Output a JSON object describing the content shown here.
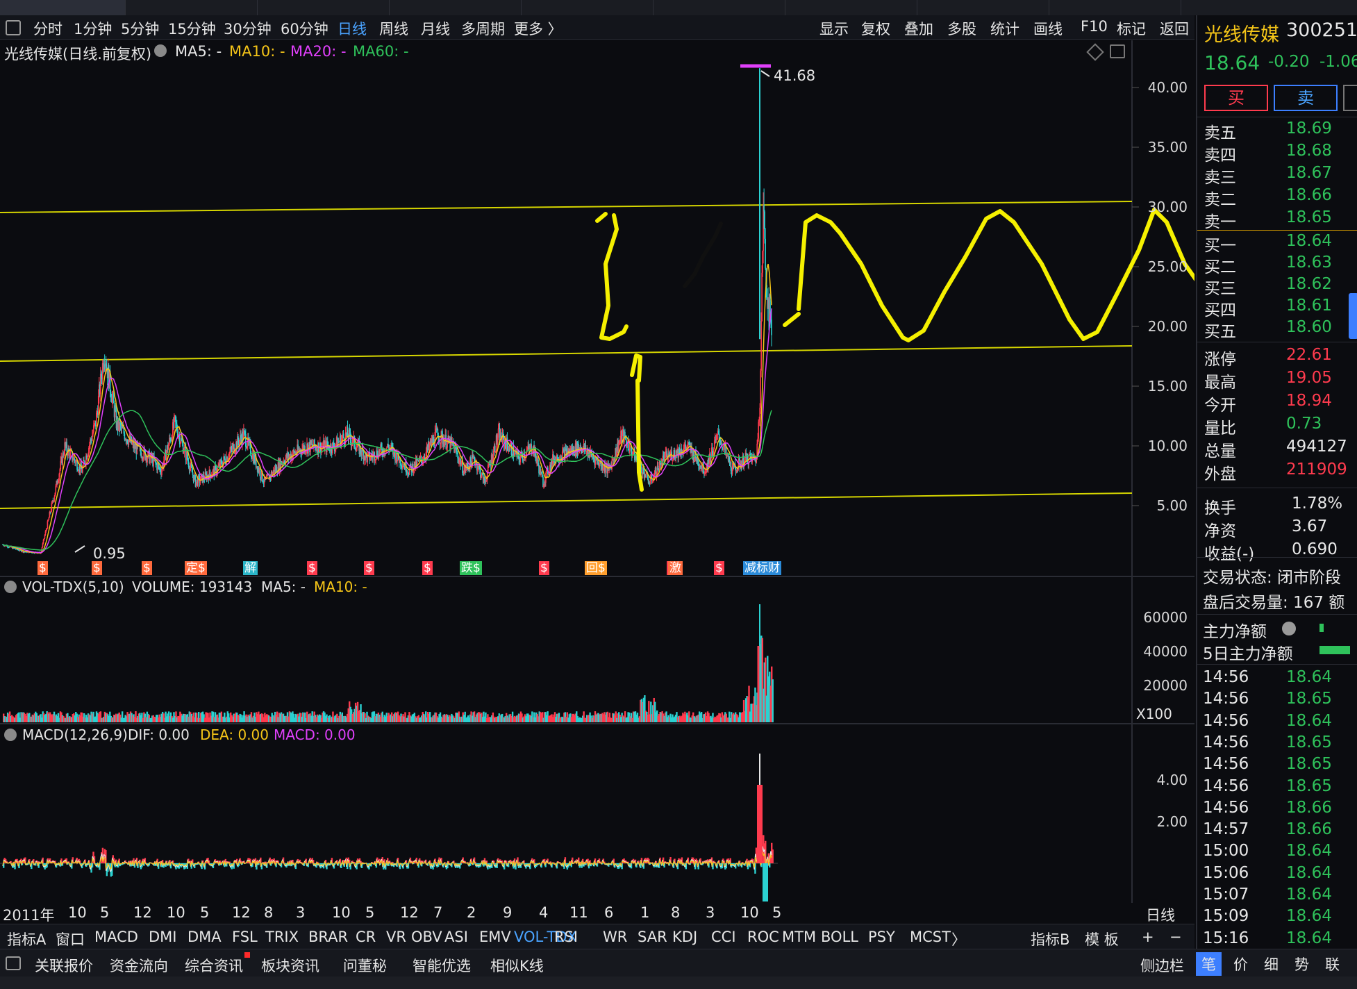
{
  "period_bar": {
    "items": [
      "分时",
      "1分钟",
      "5分钟",
      "15分钟",
      "30分钟",
      "60分钟",
      "日线",
      "周线",
      "月线",
      "多周期",
      "更多 〉"
    ],
    "active": "日线",
    "right_items": [
      "显示",
      "复权",
      "叠加",
      "多股",
      "统计",
      "画线",
      "F10",
      "标记",
      "返回"
    ]
  },
  "title_bar": {
    "name": "光线传媒(日线.前复权)",
    "ma5": "MA5: -",
    "ma10": "MA10: -",
    "ma20": "MA20: -",
    "ma60": "MA60: -"
  },
  "price_axis": {
    "labels": [
      "40.00",
      "35.00",
      "30.00",
      "25.00",
      "20.00",
      "15.00",
      "10.00",
      "5.00"
    ],
    "high_label": "41.68",
    "low_label": "0.95"
  },
  "event_markers": [
    "$",
    "$",
    "$",
    "定$",
    "解",
    "$",
    "$",
    "$",
    "跌$",
    "$",
    "回$",
    "$",
    "激",
    "$",
    "减标财"
  ],
  "volume_panel": {
    "title": "VOL-TDX(5,10)",
    "volume": "VOLUME: 193143",
    "ma5": "MA5: -",
    "ma10": "MA10: -",
    "labels": [
      "60000",
      "40000",
      "20000"
    ],
    "unit": "X100"
  },
  "macd_panel": {
    "title": "MACD(12,26,9)",
    "dif": "DIF: 0.00",
    "dea": "DEA: 0.00",
    "macd": "MACD: 0.00",
    "labels": [
      "4.00",
      "2.00"
    ]
  },
  "x_axis": {
    "labels": [
      "2011年",
      "10",
      "5",
      "12",
      "10",
      "5",
      "12",
      "8",
      "3",
      "10",
      "5",
      "12",
      "7",
      "2",
      "9",
      "4",
      "11",
      "6",
      "1",
      "8",
      "3",
      "10",
      "5"
    ],
    "period": "日线"
  },
  "indicator_bar": {
    "items": [
      "指标A",
      "窗口",
      "MACD",
      "DMI",
      "DMA",
      "FSL",
      "TRIX",
      "BRAR",
      "CR",
      "VR",
      "OBV",
      "ASI",
      "EMV",
      "VOL-TDX",
      "RSI",
      "WR",
      "SAR",
      "KDJ",
      "CCI",
      "ROC",
      "MTM",
      "BOLL",
      "PSY",
      "MCST",
      "〉"
    ],
    "active": "VOL-TDX",
    "right_items": [
      "指标B",
      "模 板",
      "+",
      "−"
    ]
  },
  "bottom_bar": {
    "items": [
      "关联报价",
      "资金流向",
      "综合资讯",
      "板块资讯",
      "问董秘",
      "智能优选",
      "相似K线"
    ],
    "right_item": "侧边栏",
    "right_tabs": [
      "笔",
      "价",
      "细",
      "势",
      "联"
    ]
  },
  "quote": {
    "name": "光线传媒",
    "code": "300251",
    "price": "18.64",
    "change": "-0.20",
    "change_pct": "-1.06",
    "buy_label": "买",
    "sell_label": "卖",
    "asks": [
      {
        "label": "卖五",
        "price": "18.69"
      },
      {
        "label": "卖四",
        "price": "18.68"
      },
      {
        "label": "卖三",
        "price": "18.67"
      },
      {
        "label": "卖二",
        "price": "18.66"
      },
      {
        "label": "卖一",
        "price": "18.65"
      }
    ],
    "bids": [
      {
        "label": "买一",
        "price": "18.64"
      },
      {
        "label": "买二",
        "price": "18.63"
      },
      {
        "label": "买三",
        "price": "18.62"
      },
      {
        "label": "买四",
        "price": "18.61"
      },
      {
        "label": "买五",
        "price": "18.60"
      }
    ],
    "stats": [
      {
        "label": "涨停",
        "value": "22.61",
        "color": "red"
      },
      {
        "label": "最高",
        "value": "19.05",
        "color": "red"
      },
      {
        "label": "今开",
        "value": "18.94",
        "color": "red"
      },
      {
        "label": "量比",
        "value": "0.73",
        "color": "green"
      },
      {
        "label": "总量",
        "value": "494127",
        "color": "white"
      },
      {
        "label": "外盘",
        "value": "211909",
        "color": "red"
      }
    ],
    "stats2": [
      {
        "label": "换手",
        "value": "1.78%"
      },
      {
        "label": "净资",
        "value": "3.67"
      },
      {
        "label": "收益(-)",
        "value": "0.690"
      }
    ],
    "trade_status": "交易状态: 闭市阶段",
    "after_volume": "盘后交易量: 167 额",
    "main_net": "主力净额",
    "main_net_5d": "5日主力净额",
    "ticks": [
      {
        "time": "14:56",
        "price": "18.64",
        "color": "green"
      },
      {
        "time": "14:56",
        "price": "18.65",
        "color": "green"
      },
      {
        "time": "14:56",
        "price": "18.64",
        "color": "green"
      },
      {
        "time": "14:56",
        "price": "18.65",
        "color": "green"
      },
      {
        "time": "14:56",
        "price": "18.65",
        "color": "green"
      },
      {
        "time": "14:56",
        "price": "18.65",
        "color": "green"
      },
      {
        "time": "14:56",
        "price": "18.66",
        "color": "green"
      },
      {
        "time": "14:57",
        "price": "18.66",
        "color": "green"
      },
      {
        "time": "15:00",
        "price": "18.64",
        "color": "green"
      },
      {
        "time": "15:06",
        "price": "18.64",
        "color": "green"
      },
      {
        "time": "15:07",
        "price": "18.64",
        "color": "green"
      },
      {
        "time": "15:09",
        "price": "18.64",
        "color": "green"
      },
      {
        "time": "15:16",
        "price": "18.64",
        "color": "green"
      }
    ]
  },
  "colors": {
    "up": "#ff3b4e",
    "down": "#2fc25b",
    "accent": "#4aa3ff",
    "annotation": "#f5f000",
    "trendline": "#d6d600"
  }
}
